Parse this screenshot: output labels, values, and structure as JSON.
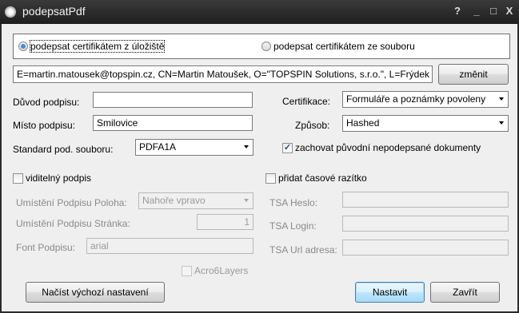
{
  "window": {
    "title": "podepsatPdf",
    "controls": [
      "?",
      "_",
      "□",
      "X"
    ]
  },
  "source": {
    "radio_store": "podepsat certifikátem z úložiště",
    "radio_file": "podepsat certifikátem ze souboru",
    "selected": "store"
  },
  "certificate": {
    "subject": "E=martin.matousek@topspin.cz, CN=Martin Matoušek, O=\"TOPSPIN Solutions, s.r.o.\", L=Frýdek",
    "change_button": "změnit"
  },
  "form": {
    "reason_label": "Důvod podpisu:",
    "reason_value": "",
    "place_label": "Místo podpisu:",
    "place_value": "Smilovice",
    "standard_label": "Standard pod. souboru:",
    "standard_value": "PDFA1A",
    "certification_label": "Certifikace:",
    "certification_value": "Formuláře a poznámky povoleny",
    "method_label": "Způsob:",
    "method_value": "Hashed",
    "keep_original_label": "zachovat původní nepodepsané dokumenty",
    "keep_original_checked": true
  },
  "visible_signature": {
    "checkbox_label": "viditelný podpis",
    "position_label": "Umístění Podpisu Poloha:",
    "position_value": "Nahoře vpravo",
    "page_label": "Umístění Podpisu Stránka:",
    "page_value": "1",
    "font_label": "Font Podpisu:",
    "font_value": "arial",
    "acro6_label": "Acro6Layers"
  },
  "timestamp": {
    "checkbox_label": "přidat časové razítko",
    "password_label": "TSA Heslo:",
    "login_label": "TSA Login:",
    "url_label": "TSA Url adresa:"
  },
  "buttons": {
    "load_defaults": "Načíst výchozí nastavení",
    "apply": "Nastavit",
    "close": "Zavřít"
  }
}
